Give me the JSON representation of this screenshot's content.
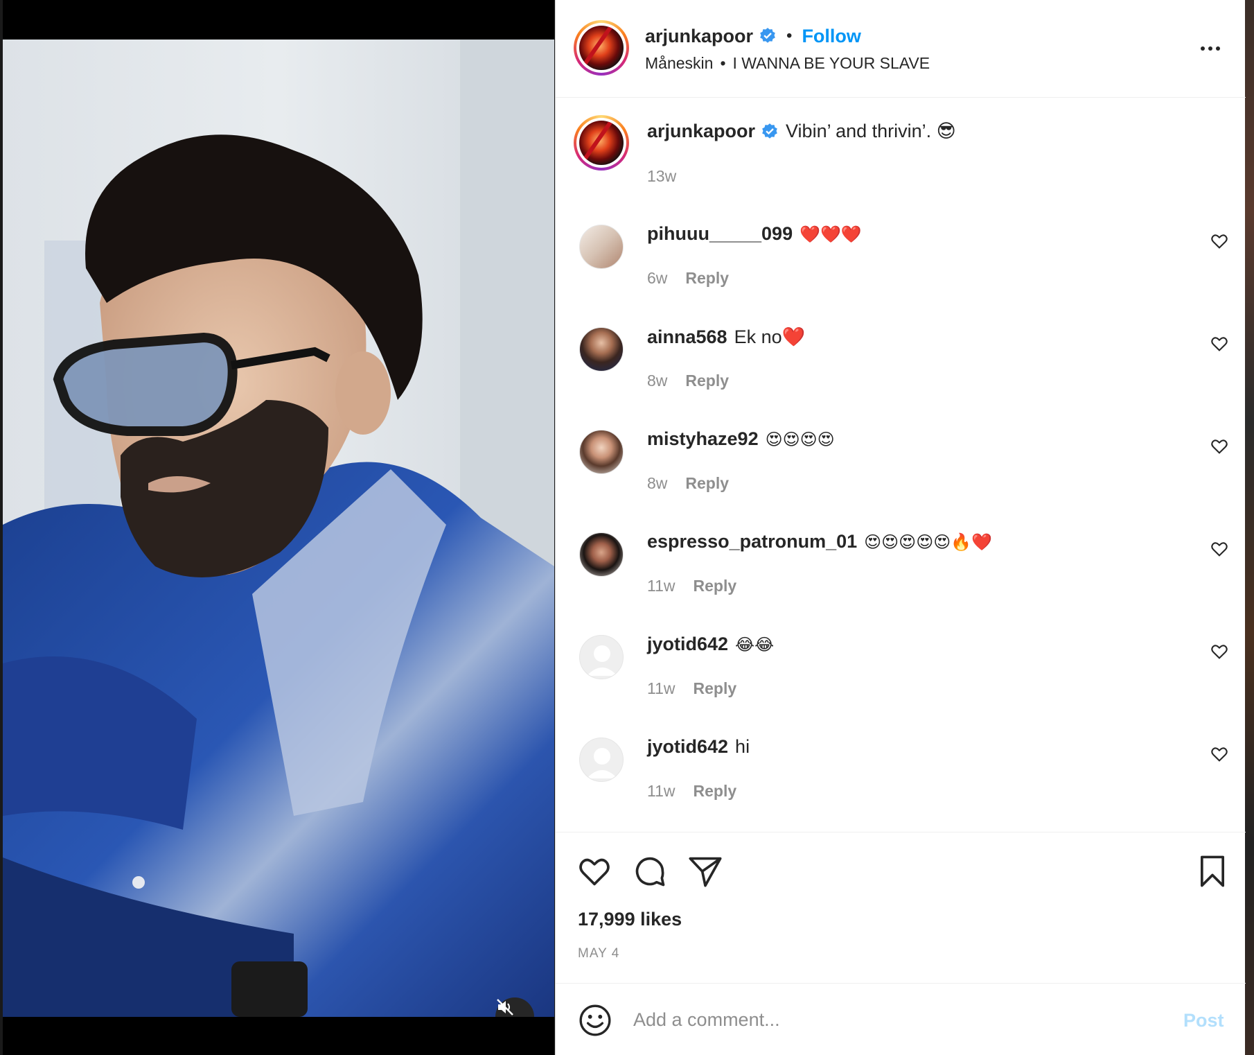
{
  "post": {
    "username": "arjunkapoor",
    "follow_label": "Follow",
    "separator": "•",
    "audio_artist": "Måneskin",
    "audio_track": "I WANNA BE YOUR SLAVE",
    "caption": "Vibin’ and thrivin’. 😎",
    "caption_age": "13w",
    "likes": "17,999 likes",
    "date": "MAY 4"
  },
  "comments": [
    {
      "user": "pihuuu_____099",
      "text": "❤️❤️❤️",
      "age": "6w",
      "reply": "Reply"
    },
    {
      "user": "ainna568",
      "text": "Ek no❤️",
      "age": "8w",
      "reply": "Reply"
    },
    {
      "user": "mistyhaze92",
      "text": "😍😍😍😍",
      "age": "8w",
      "reply": "Reply"
    },
    {
      "user": "espresso_patronum_01",
      "text": "😍😍😍😍😍🔥❤️",
      "age": "11w",
      "reply": "Reply"
    },
    {
      "user": "jyotid642",
      "text": "😂😂",
      "age": "11w",
      "reply": "Reply"
    },
    {
      "user": "jyotid642",
      "text": "hi",
      "age": "11w",
      "reply": "Reply"
    }
  ],
  "comment_box": {
    "placeholder": "Add a comment...",
    "post_label": "Post"
  },
  "colors": {
    "accent": "#0095f6",
    "post_disabled": "#b2dffc",
    "text": "#262626",
    "muted": "#8e8e8e"
  },
  "icons": {
    "verified": "verified-badge-icon",
    "more": "more-options-icon",
    "like": "heart-icon",
    "comment": "comment-bubble-icon",
    "share": "paper-plane-icon",
    "save": "bookmark-icon",
    "emoji": "emoji-smiley-icon",
    "mute": "speaker-muted-icon"
  }
}
